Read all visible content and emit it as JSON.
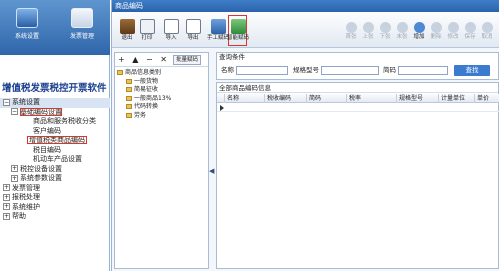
{
  "modules": [
    {
      "label": "系统设置"
    },
    {
      "label": "发票管理"
    }
  ],
  "brand": "增值税发票税控开票软件",
  "nav": {
    "system_settings": "系统设置",
    "basic_codes": "基础编码设置",
    "goods_codes": "商品和服务税收分类",
    "customer_codes": "客户编码",
    "vat_goods_codes": "增值税类商品编码",
    "tax_codes": "税目编码",
    "vehicle_codes": "机动车产品设置",
    "tax_device_settings": "税控设备设置",
    "system_params": "系统参数设置",
    "invoice_mgmt": "发票管理",
    "tax_processing": "报税处理",
    "system_maintenance": "系统维护",
    "help": "帮助"
  },
  "dialog": {
    "title": "商品编码",
    "toolbar": {
      "exit": "退出",
      "print": "打印",
      "import": "导入",
      "export": "导出",
      "manual_code": "手工赋码",
      "smart_code": "智能赋码",
      "first": "首张",
      "prev": "上张",
      "next": "下张",
      "last": "末张",
      "add": "增加",
      "delete": "删除",
      "modify": "修改",
      "save": "保存",
      "cancel": "取消"
    },
    "tree_tools": {
      "add_symbol": "+",
      "up_symbol": "▲",
      "minus_symbol": "−",
      "close_symbol": "✕",
      "batch_label": "批量赋码"
    },
    "tree": {
      "root": "商品信息类别",
      "children": [
        "一般货物",
        "简易征收",
        "一般商品13%",
        "代码转换",
        "劳务"
      ]
    },
    "query": {
      "heading": "查询条件",
      "name_label": "名称",
      "spec_label": "规格型号",
      "short_code_label": "简码",
      "search_button": "查找"
    },
    "grid": {
      "heading": "全部商品编码信息",
      "columns": [
        "名称",
        "税收编码",
        "简码",
        "税率",
        "规格型号",
        "计量单位",
        "单价"
      ]
    }
  }
}
